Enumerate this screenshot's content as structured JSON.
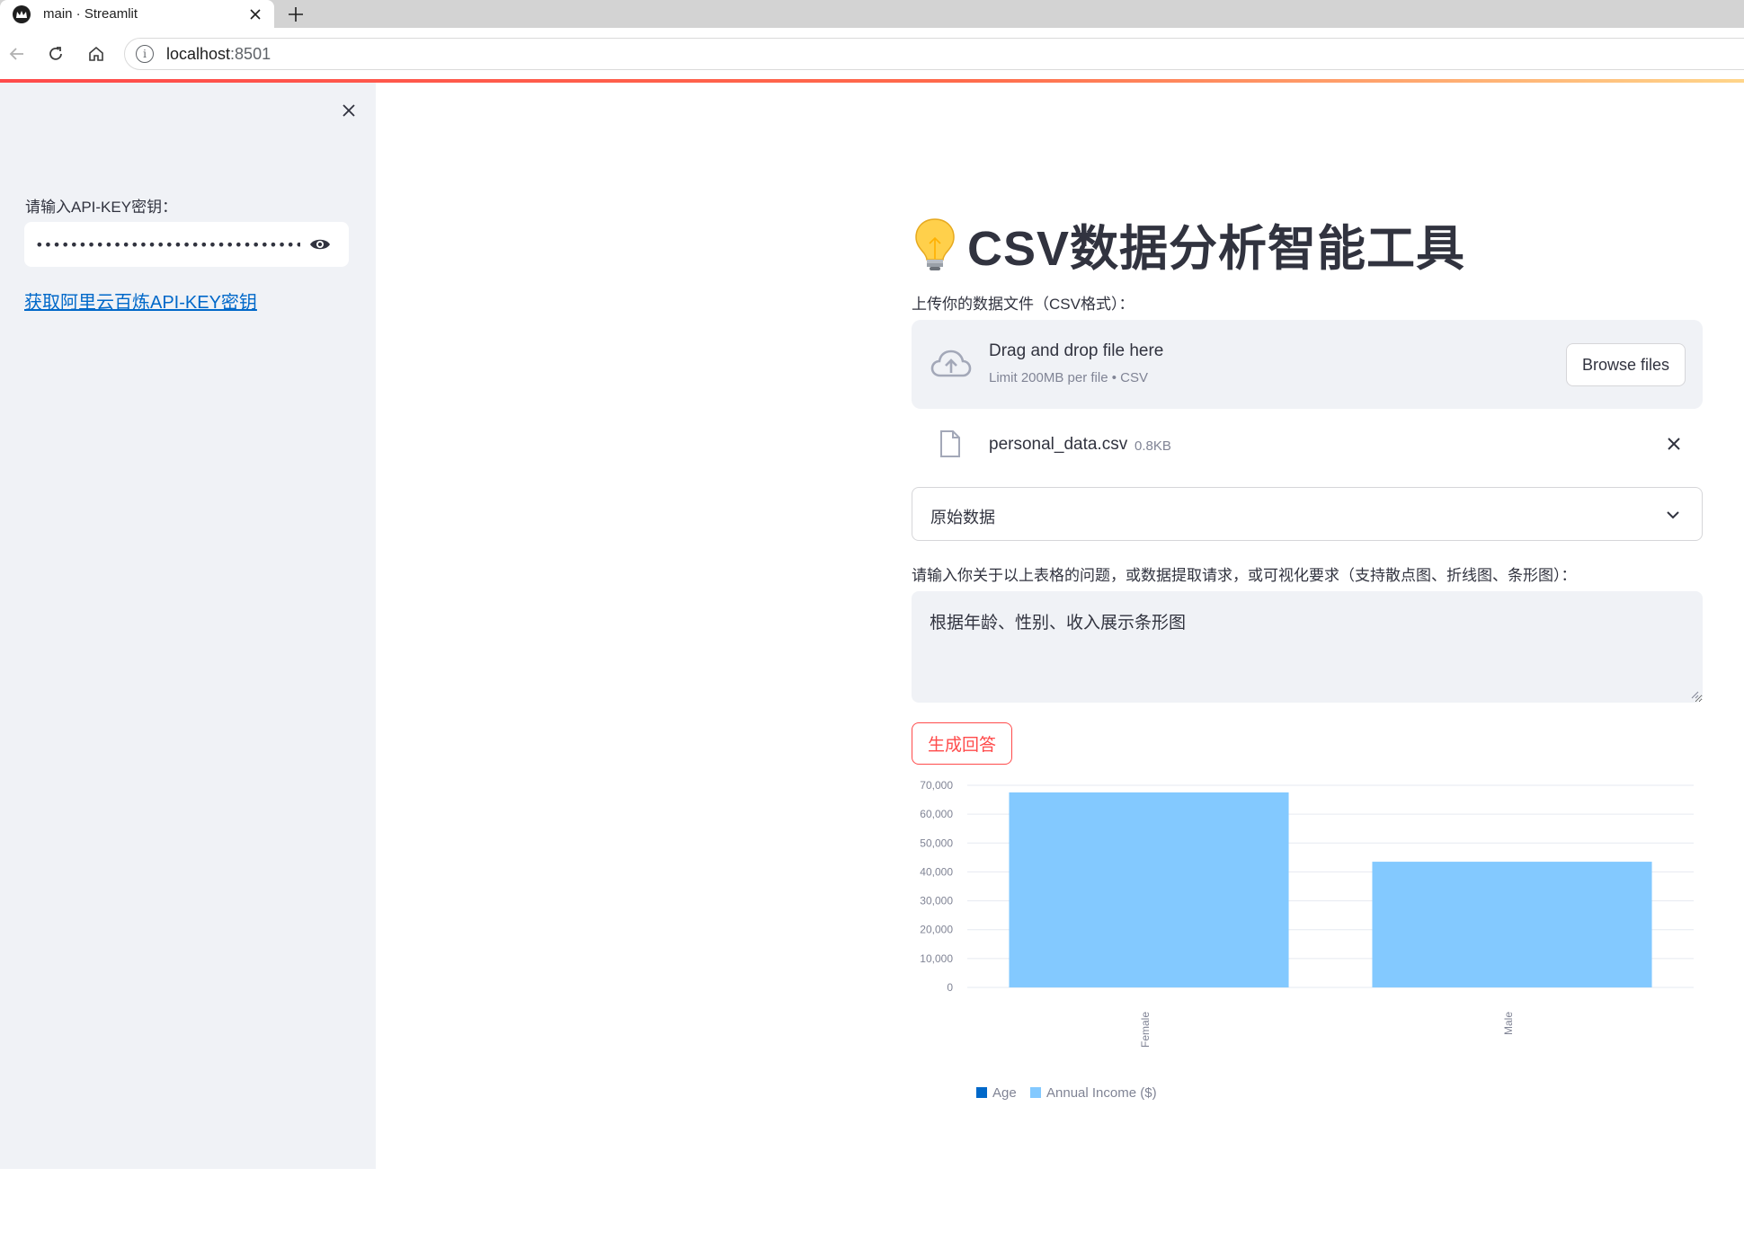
{
  "browser": {
    "tab_title": "main · Streamlit",
    "url_host": "localhost",
    "url_port": ":8501"
  },
  "sidebar": {
    "api_key_label": "请输入API-KEY密钥：",
    "api_key_value": "••••••••••••••••••••••••••••••••••••",
    "link_text": "获取阿里云百炼API-KEY密钥"
  },
  "main": {
    "title": "CSV数据分析智能工具",
    "uploader": {
      "label": "上传你的数据文件（CSV格式）：",
      "dropzone_title": "Drag and drop file here",
      "dropzone_sub": "Limit 200MB per file • CSV",
      "browse_label": "Browse files"
    },
    "file": {
      "name": "personal_data.csv",
      "size": "0.8KB"
    },
    "expander_label": "原始数据",
    "question": {
      "label": "请输入你关于以上表格的问题，或数据提取请求，或可视化要求（支持散点图、折线图、条形图）：",
      "value": "根据年龄、性别、收入展示条形图"
    },
    "submit_label": "生成回答"
  },
  "icons": {
    "tab_favicon": "streamlit-crown-icon",
    "tab_close": "close-icon",
    "new_tab": "plus-icon",
    "back": "arrow-left-icon",
    "reload": "reload-icon",
    "home": "home-icon",
    "site_info": "info-icon",
    "sidebar_close": "close-icon",
    "password_toggle": "eye-icon",
    "title_emoji": "lightbulb-icon",
    "upload": "cloud-upload-icon",
    "file": "file-icon",
    "file_remove": "close-icon",
    "expander": "chevron-down-icon"
  },
  "colors": {
    "accent": "#ff4b4b",
    "link": "#0068c9",
    "sidebar_bg": "#f0f2f6",
    "series_age": "#0068c9",
    "series_income": "#83c9ff"
  },
  "chart_data": {
    "type": "bar",
    "categories": [
      "Female",
      "Male"
    ],
    "series": [
      {
        "name": "Age",
        "values": [
          32,
          30
        ]
      },
      {
        "name": "Annual Income ($)",
        "values": [
          67500,
          43500
        ]
      }
    ],
    "ylim": [
      0,
      70000
    ],
    "yticks": [
      0,
      10000,
      20000,
      30000,
      40000,
      50000,
      60000,
      70000
    ],
    "ytick_labels": [
      "0",
      "10,000",
      "20,000",
      "30,000",
      "40,000",
      "50,000",
      "60,000",
      "70,000"
    ],
    "legend": [
      "Age",
      "Annual Income ($)"
    ],
    "legend_position": "bottom",
    "grid": true,
    "stacked": true
  }
}
